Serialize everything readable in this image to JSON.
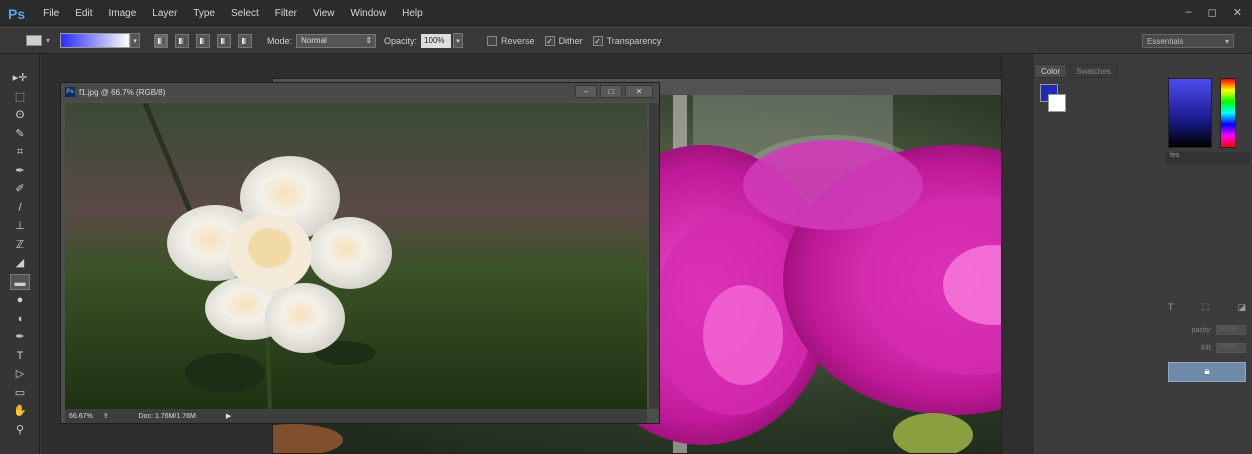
{
  "app": {
    "logo": "Ps"
  },
  "menu": [
    "File",
    "Edit",
    "Image",
    "Layer",
    "Type",
    "Select",
    "Filter",
    "View",
    "Window",
    "Help"
  ],
  "window_controls": {
    "minimize": "–",
    "maximize": "◻",
    "close": "✕"
  },
  "options": {
    "mode_label": "Mode:",
    "mode_value": "Normal",
    "opacity_label": "Opacity:",
    "opacity_value": "100%",
    "reverse_label": "Reverse",
    "dither_label": "Dither",
    "transparency_label": "Transparency",
    "reverse_checked": false,
    "dither_checked": true,
    "transparency_checked": true,
    "workspace_value": "Essentials",
    "gradient_start": "#2a2aff",
    "gradient_end": "#ffffff"
  },
  "tools": [
    "move-tool",
    "marquee-tool",
    "lasso-tool",
    "quick-selection-tool",
    "crop-tool",
    "eyedropper-tool",
    "healing-brush-tool",
    "brush-tool",
    "clone-stamp-tool",
    "history-brush-tool",
    "eraser-tool",
    "gradient-tool",
    "blur-tool",
    "dodge-tool",
    "pen-tool",
    "type-tool",
    "path-selection-tool",
    "rectangle-tool",
    "hand-tool",
    "zoom-tool"
  ],
  "front_document": {
    "title": "f1.jpg @ 66.7% (RGB/8)",
    "zoom": "66.67%",
    "doc_size": "Doc: 1.76M/1.76M",
    "ctrl_min": "–",
    "ctrl_max": "□",
    "ctrl_close": "✕"
  },
  "back_document": {
    "ctrl_min": "–",
    "ctrl_max": "□",
    "ctrl_close": "✕"
  },
  "panels": {
    "color_tab": "Color",
    "swatches_tab": "Swatches",
    "fg_color": "#1f2ab8",
    "bg_color": "#ffffff",
    "adjustments_label": "fes",
    "opacity_label": "pacity:",
    "opacity_value": "100%",
    "fill_label": "Fill:",
    "fill_value": "100%"
  }
}
